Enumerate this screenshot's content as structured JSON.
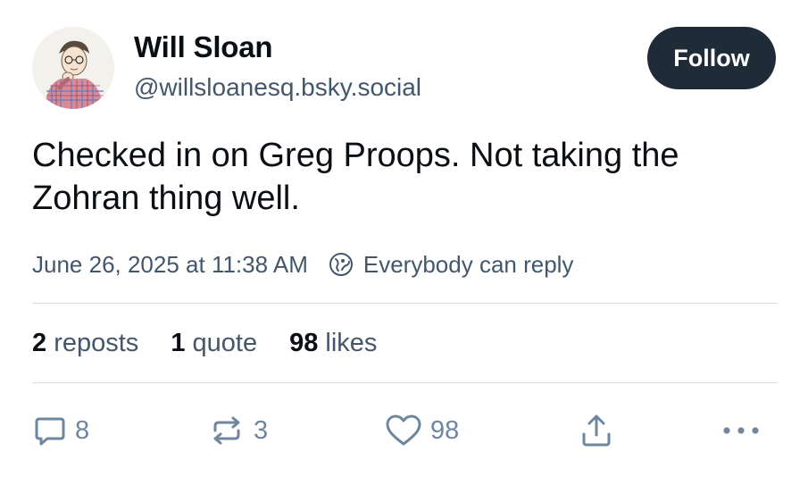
{
  "author": {
    "display_name": "Will Sloan",
    "handle": "@willsloanesq.bsky.social",
    "avatar_icon": "avatar-illustration"
  },
  "follow_label": "Follow",
  "post": {
    "text": "Checked in on Greg Proops. Not taking the Zohran thing well.",
    "timestamp": "June 26, 2025 at 11:38 AM",
    "reply_setting": "Everybody can reply"
  },
  "stats": {
    "reposts_count": "2",
    "reposts_label": "reposts",
    "quotes_count": "1",
    "quotes_label": "quote",
    "likes_count": "98",
    "likes_label": "likes"
  },
  "actions": {
    "reply_count": "8",
    "repost_count": "3",
    "like_count": "98",
    "reply_icon": "speech-bubble-icon",
    "repost_icon": "repost-arrows-icon",
    "like_icon": "heart-icon",
    "share_icon": "share-icon",
    "more_icon": "ellipsis-icon"
  },
  "colors": {
    "follow_button": "#202b38",
    "secondary_text": "#42576c",
    "action_icons": "#6f869f",
    "divider": "#d4dbe2"
  }
}
